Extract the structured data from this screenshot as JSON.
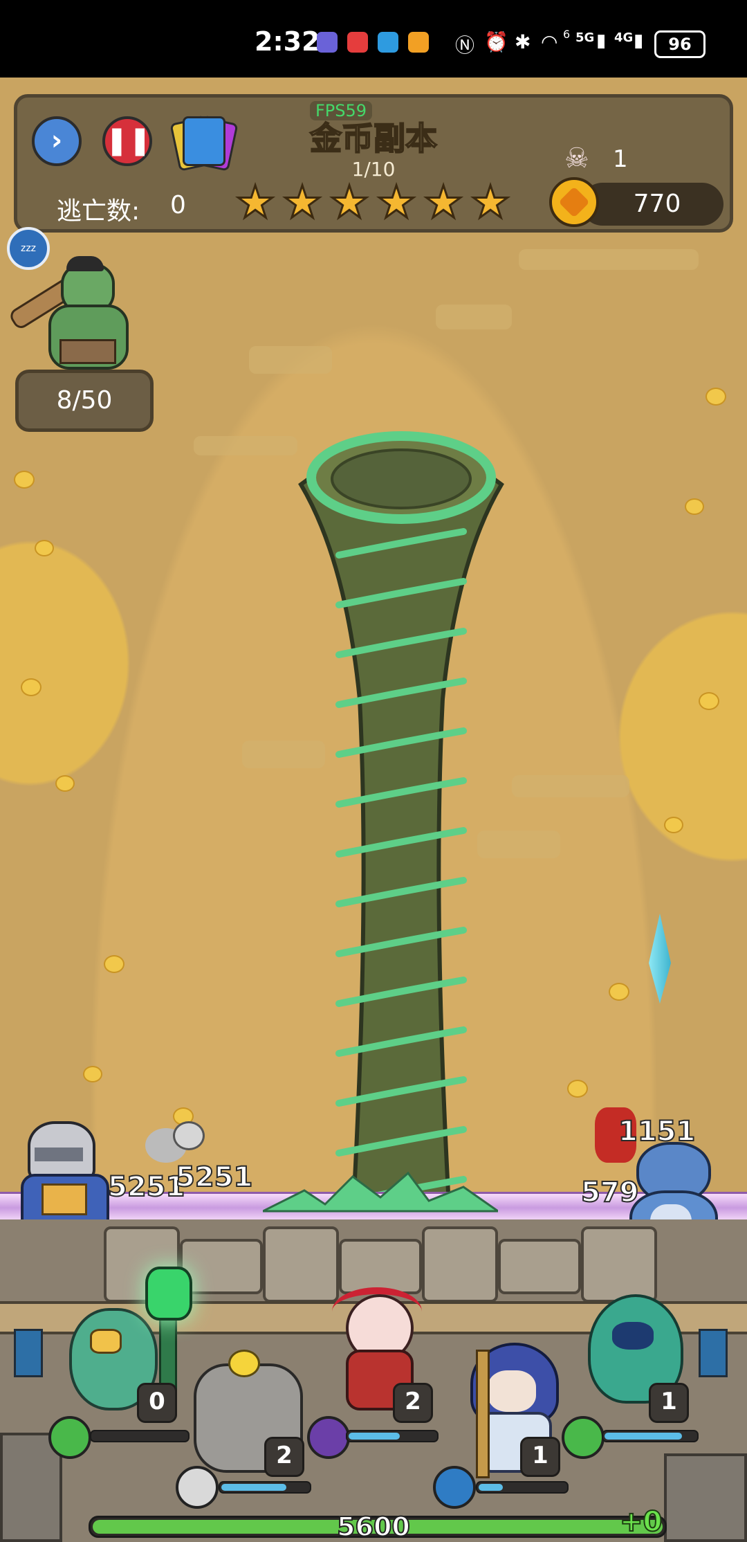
{
  "status_bar": {
    "time": "2:32",
    "battery": "96",
    "network_1": "5G",
    "network_2": "4G",
    "wifi_badge": "6"
  },
  "hud": {
    "fps": "FPS59",
    "title": "金币副本",
    "wave": "1/10",
    "escape_label": "逃亡数:",
    "escape_value": "0",
    "stars": 6,
    "kills": "1",
    "coins": "770",
    "buttons": [
      "play-icon",
      "pause-icon",
      "cards-icon"
    ]
  },
  "left_panel": {
    "sleep_label": "zzz",
    "enemy_count": "8/50"
  },
  "battle": {
    "damage_numbers": [
      "5251",
      "5251",
      "1151",
      "579"
    ]
  },
  "heroes": [
    {
      "name": "owl-druid",
      "level": "0",
      "skill_icon": "wind-icon",
      "bar": 0.0
    },
    {
      "name": "rock-golem",
      "level": "2",
      "skill_icon": "rock-icon",
      "bar": 0.75
    },
    {
      "name": "horned-sorceress",
      "level": "2",
      "skill_icon": "claw-icon",
      "bar": 0.6
    },
    {
      "name": "ice-mage",
      "level": "1",
      "skill_icon": "crystal-icon",
      "bar": 0.3
    },
    {
      "name": "wind-spirit",
      "level": "1",
      "skill_icon": "tornado-icon",
      "bar": 0.85
    }
  ],
  "base": {
    "hp": "5600",
    "hp_delta": "+0",
    "hp_fraction": 1.0
  },
  "colors": {
    "accent_green": "#62c84b",
    "tornado": "#5b6a3a",
    "tornado_stripe": "#5ecf88",
    "coin": "#f3b21b"
  }
}
